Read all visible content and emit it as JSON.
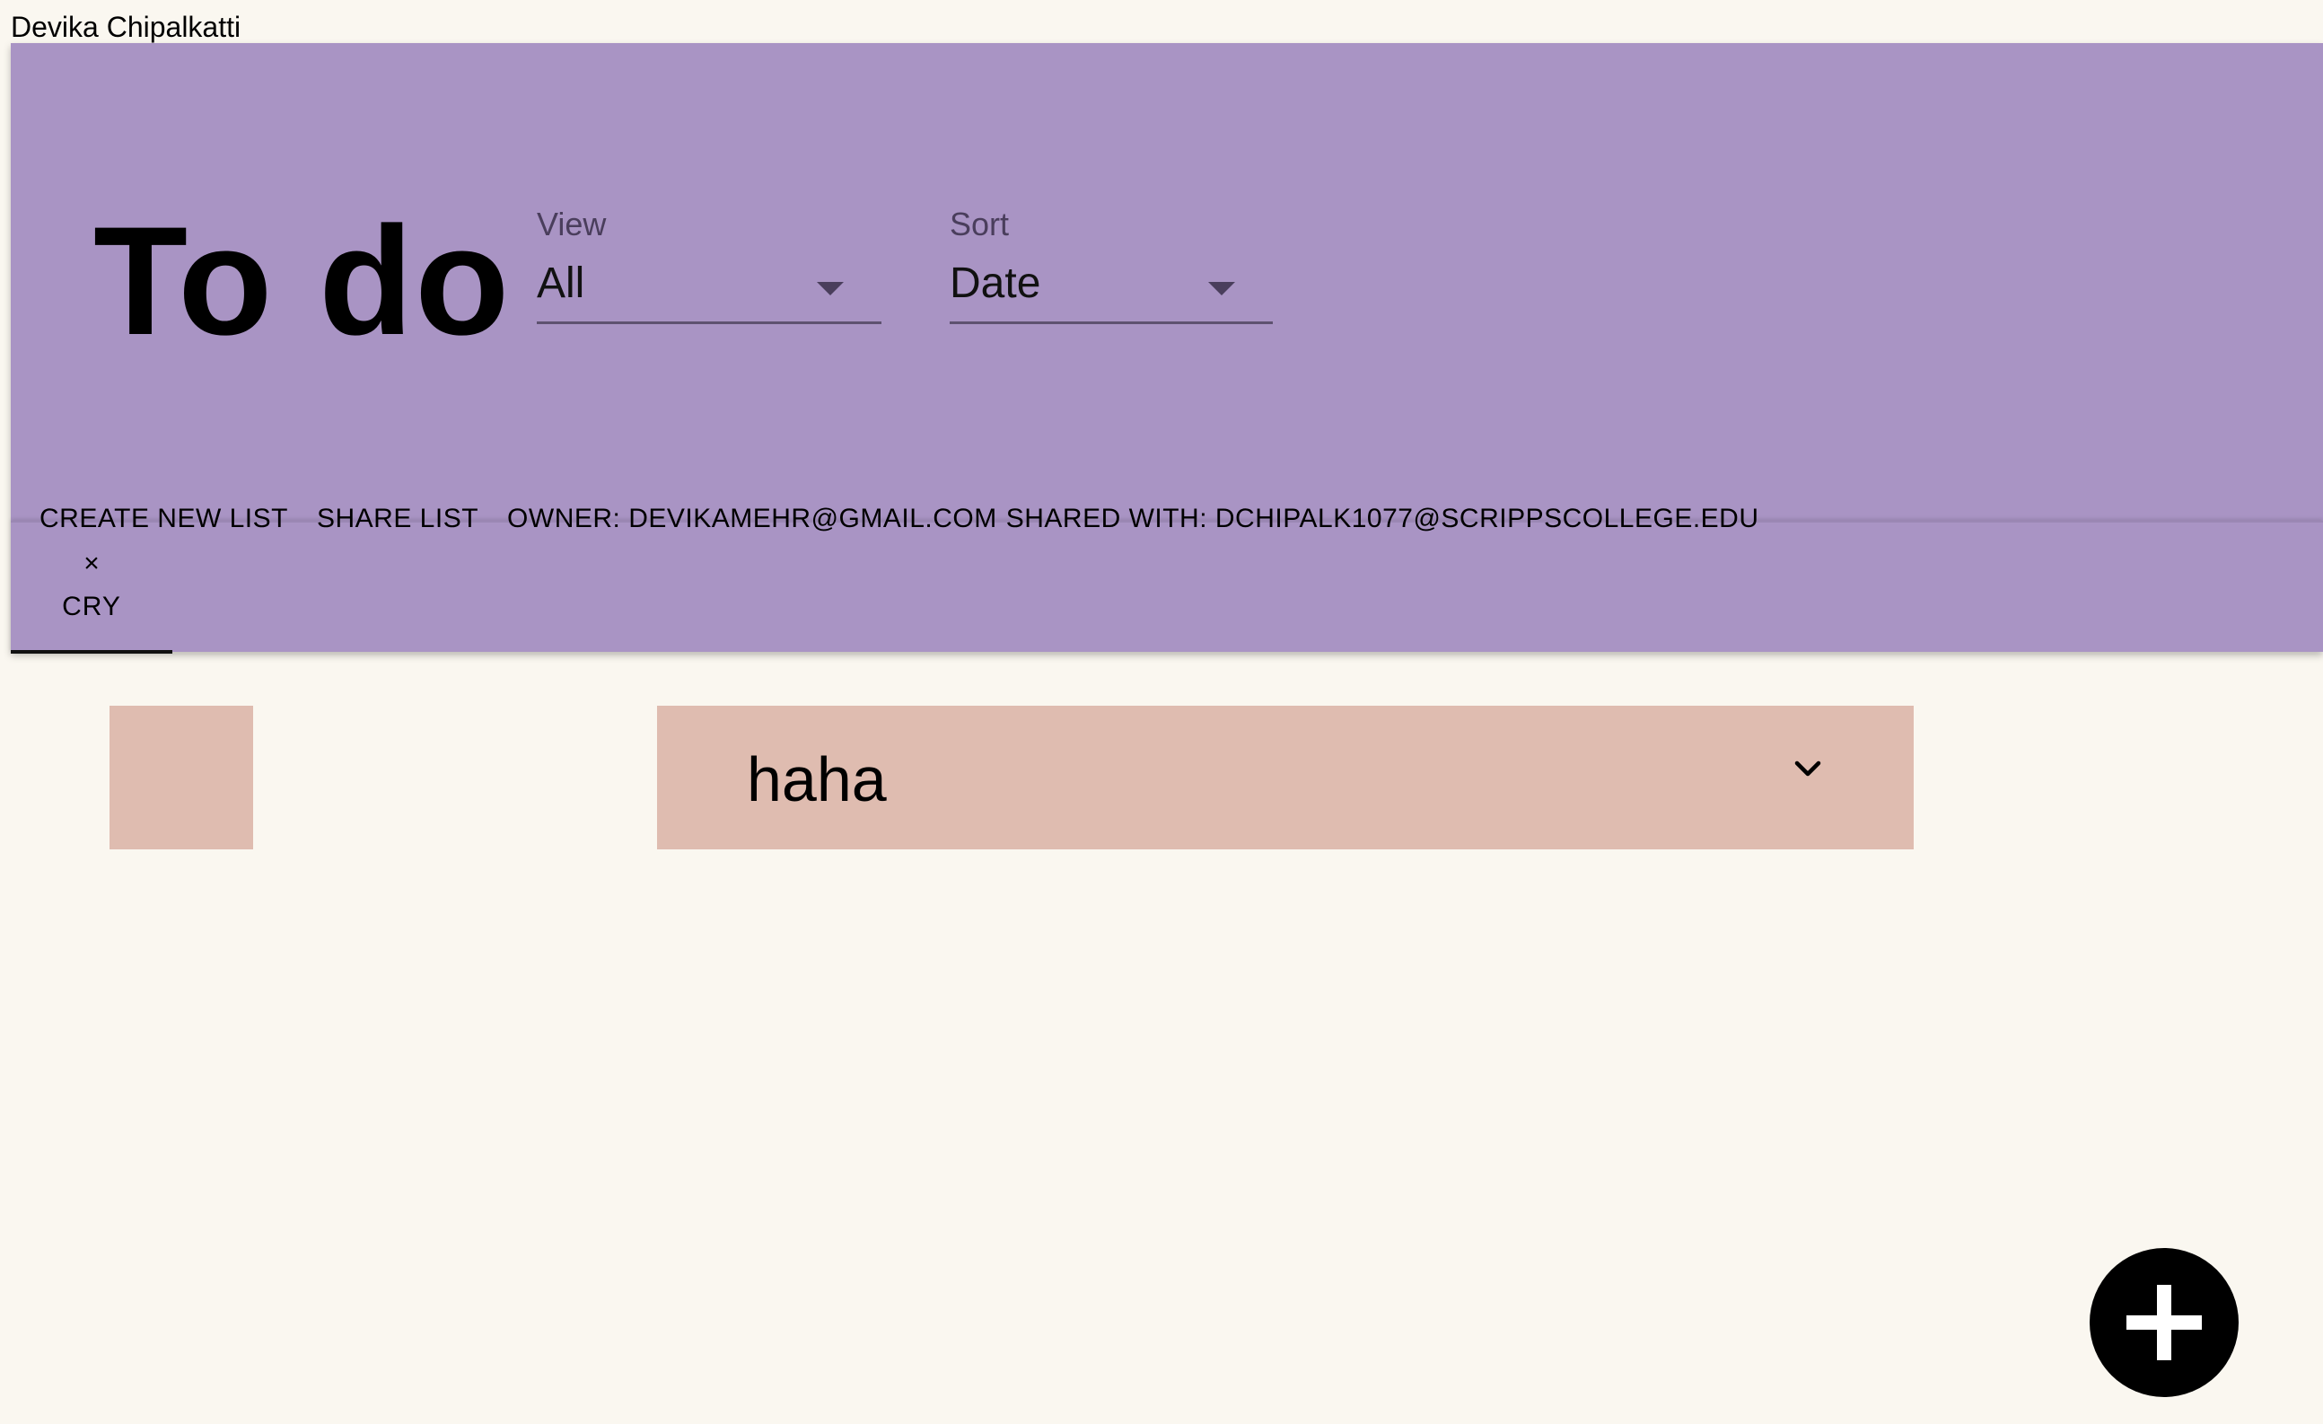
{
  "user": {
    "name": "Devika Chipalkatti"
  },
  "header": {
    "title": "To do",
    "view": {
      "label": "View",
      "value": "All"
    },
    "sort": {
      "label": "Sort",
      "value": "Date"
    },
    "actions": {
      "create_new_list": "Create new list",
      "share_list": "Share list"
    },
    "info": {
      "owner": "OWNER: DEVIKAMEHR@GMAIL.COM",
      "shared_with": "SHARED WITH: DCHIPALK1077@SCRIPPSCOLLEGE.EDU"
    },
    "accent_color": "#a994c4"
  },
  "tabs": [
    {
      "label": "CRY",
      "close_glyph": "×",
      "selected": true
    }
  ],
  "tasks": [
    {
      "text": "haha",
      "completed": false,
      "expand_icon": "chevron-down-icon"
    }
  ],
  "fab": {
    "icon": "plus-icon"
  },
  "colors": {
    "background": "#faf7f0",
    "task_card": "#dfbcb0",
    "fab": "#000000"
  }
}
